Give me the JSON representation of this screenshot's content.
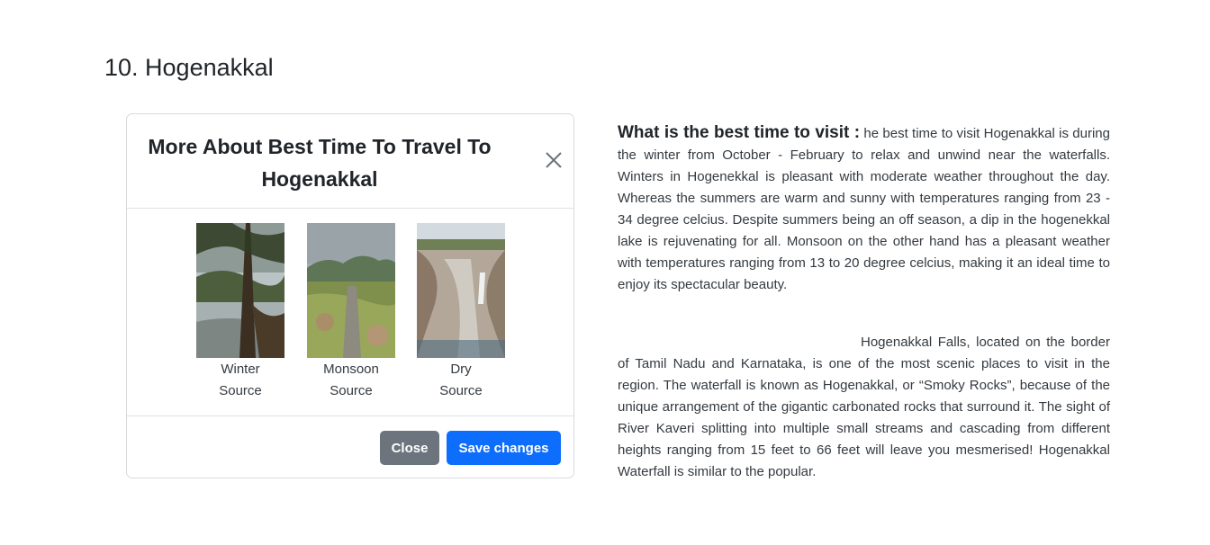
{
  "heading": "10. Hogenakkal",
  "modal": {
    "title": "More About Best Time To Travel To Hogenakkal",
    "close_icon": "close-icon",
    "figures": [
      {
        "season": "Winter",
        "source": "Source"
      },
      {
        "season": "Monsoon",
        "source": "Source"
      },
      {
        "season": "Dry",
        "source": "Source"
      }
    ],
    "close_label": "Close",
    "save_label": "Save changes",
    "colors": {
      "close_button": "#6c757d",
      "save_button": "#0d6efd"
    }
  },
  "article": {
    "question": "What is the best time to visit :",
    "answer": "he best time to visit Hogenakkal is during the winter from October - February to relax and unwind near the waterfalls. Winters in Hogenekkal is pleasant with moderate weather throughout the day. Whereas the summers are warm and sunny with temperatures ranging from 23 - 34 degree celcius. Despite summers being an off season, a dip in the hogenekkal lake is rejuvenating for all. Monsoon on the other hand has a pleasant weather with temperatures ranging from 13 to 20 degree celcius, making it an ideal time to enjoy its spectacular beauty.",
    "description": "Hogenakkal Falls, located on the border of Tamil Nadu and Karnataka, is one of the most scenic places to visit in the region. The waterfall is known as Hogenakkal, or “Smoky Rocks”, because of the unique arrangement of the gigantic carbonated rocks that surround it. The sight of River Kaveri splitting into multiple small streams and cascading from different heights ranging from 15 feet to 66 feet will leave you mesmerised! Hogenakkal Waterfall is similar to the popular."
  }
}
